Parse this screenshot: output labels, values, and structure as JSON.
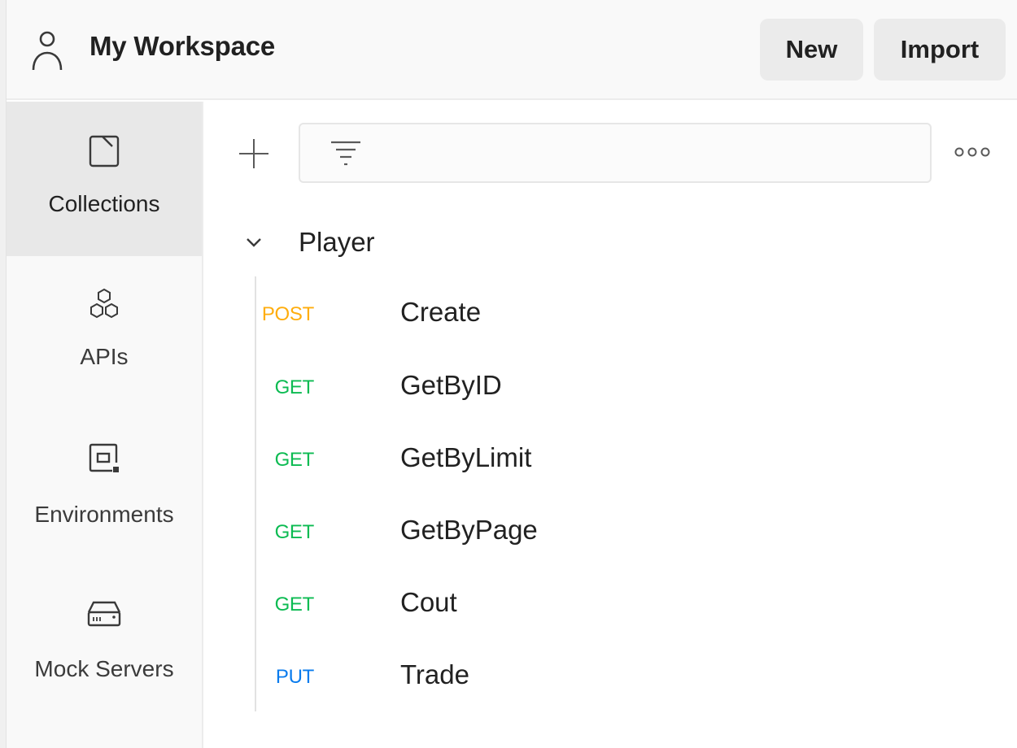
{
  "header": {
    "title": "My Workspace",
    "new_label": "New",
    "import_label": "Import"
  },
  "sidebar": {
    "items": [
      {
        "label": "Collections",
        "icon": "collection-icon",
        "active": true
      },
      {
        "label": "APIs",
        "icon": "apis-icon",
        "active": false
      },
      {
        "label": "Environments",
        "icon": "environments-icon",
        "active": false
      },
      {
        "label": "Mock Servers",
        "icon": "mock-servers-icon",
        "active": false
      }
    ]
  },
  "toolbar": {
    "filter_placeholder": ""
  },
  "collection": {
    "name": "Player",
    "expanded": true,
    "requests": [
      {
        "method": "POST",
        "name": "Create"
      },
      {
        "method": "GET",
        "name": "GetByID"
      },
      {
        "method": "GET",
        "name": "GetByLimit"
      },
      {
        "method": "GET",
        "name": "GetByPage"
      },
      {
        "method": "GET",
        "name": "Cout"
      },
      {
        "method": "PUT",
        "name": "Trade"
      }
    ]
  },
  "method_colors": {
    "POST": "#ffad0d",
    "GET": "#0cbb52",
    "PUT": "#097bed"
  }
}
